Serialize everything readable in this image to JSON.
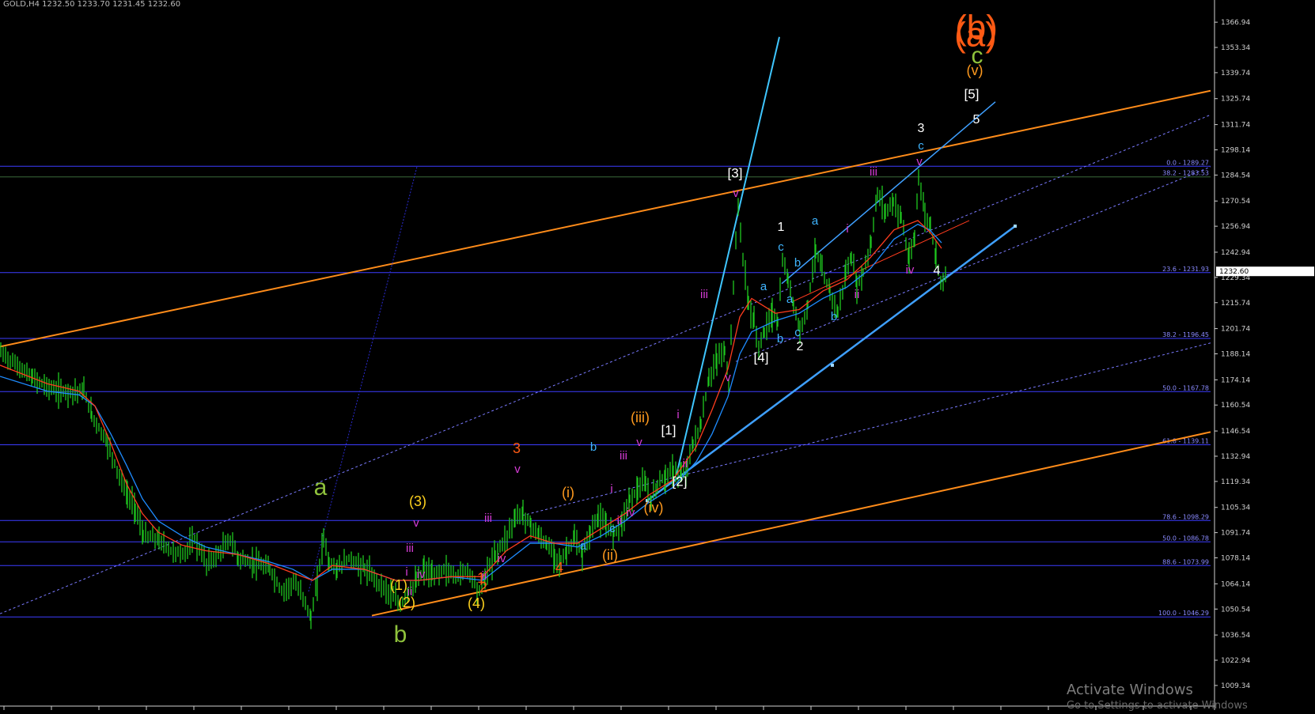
{
  "header": {
    "title_strip": "GOLD,H4 1232.50 1233.70 1231.45 1232.60"
  },
  "watermark": {
    "line1": "Activate Windows",
    "line2": "Go to Settings to activate Windows"
  },
  "chart_data": {
    "type": "line",
    "symbol": "GOLD,H4",
    "y_axis": {
      "ticks": [
        1366.94,
        1353.34,
        1339.74,
        1325.74,
        1311.74,
        1298.14,
        1284.54,
        1270.54,
        1256.94,
        1242.94,
        1229.34,
        1215.74,
        1201.74,
        1188.14,
        1174.14,
        1160.54,
        1146.54,
        1132.94,
        1119.34,
        1105.34,
        1091.74,
        1078.14,
        1064.14,
        1050.54,
        1036.54,
        1022.94,
        1009.34
      ],
      "last_price": "1232.60",
      "range": [
        1003.5,
        1377
      ]
    },
    "fib_levels": [
      {
        "label": "0.0 - 1289.27",
        "value": 1289.27
      },
      {
        "label": "38.2 - 1283.53",
        "value": 1283.53
      },
      {
        "label": "23.6 - 1231.93",
        "value": 1231.93
      },
      {
        "label": "38.2 - 1196.45",
        "value": 1196.45
      },
      {
        "label": "50.0 - 1167.78",
        "value": 1167.78
      },
      {
        "label": "61.8 - 1139.11",
        "value": 1139.11
      },
      {
        "label": "78.6 - 1098.29",
        "value": 1098.29
      },
      {
        "label": "50.0 - 1086.78",
        "value": 1086.78
      },
      {
        "label": "88.6 - 1073.99",
        "value": 1073.99
      },
      {
        "label": "100.0 - 1046.29",
        "value": 1046.29
      }
    ],
    "price_path": [
      [
        0,
        1189
      ],
      [
        40,
        1175
      ],
      [
        70,
        1168
      ],
      [
        105,
        1168
      ],
      [
        115,
        1155
      ],
      [
        135,
        1140
      ],
      [
        150,
        1122
      ],
      [
        160,
        1112
      ],
      [
        170,
        1105
      ],
      [
        180,
        1090
      ],
      [
        200,
        1088
      ],
      [
        215,
        1082
      ],
      [
        230,
        1080
      ],
      [
        245,
        1088
      ],
      [
        260,
        1075
      ],
      [
        275,
        1080
      ],
      [
        290,
        1088
      ],
      [
        300,
        1078
      ],
      [
        320,
        1075
      ],
      [
        340,
        1072
      ],
      [
        355,
        1060
      ],
      [
        370,
        1065
      ],
      [
        385,
        1055
      ],
      [
        392,
        1045
      ],
      [
        400,
        1065
      ],
      [
        408,
        1090
      ],
      [
        415,
        1075
      ],
      [
        425,
        1072
      ],
      [
        440,
        1078
      ],
      [
        460,
        1072
      ],
      [
        475,
        1066
      ],
      [
        490,
        1060
      ],
      [
        505,
        1052
      ],
      [
        515,
        1060
      ],
      [
        525,
        1065
      ],
      [
        535,
        1072
      ],
      [
        545,
        1068
      ],
      [
        560,
        1072
      ],
      [
        575,
        1068
      ],
      [
        590,
        1072
      ],
      [
        605,
        1060
      ],
      [
        612,
        1068
      ],
      [
        625,
        1080
      ],
      [
        640,
        1090
      ],
      [
        650,
        1100
      ],
      [
        660,
        1102
      ],
      [
        670,
        1096
      ],
      [
        680,
        1090
      ],
      [
        690,
        1085
      ],
      [
        700,
        1080
      ],
      [
        708,
        1075
      ],
      [
        715,
        1082
      ],
      [
        725,
        1088
      ],
      [
        735,
        1080
      ],
      [
        745,
        1092
      ],
      [
        755,
        1100
      ],
      [
        765,
        1095
      ],
      [
        775,
        1092
      ],
      [
        785,
        1098
      ],
      [
        795,
        1110
      ],
      [
        805,
        1115
      ],
      [
        815,
        1118
      ],
      [
        822,
        1108
      ],
      [
        830,
        1118
      ],
      [
        840,
        1122
      ],
      [
        850,
        1125
      ],
      [
        860,
        1122
      ],
      [
        868,
        1128
      ],
      [
        875,
        1140
      ],
      [
        885,
        1150
      ],
      [
        895,
        1175
      ],
      [
        905,
        1185
      ],
      [
        915,
        1190
      ],
      [
        920,
        1172
      ],
      [
        926,
        1225
      ],
      [
        932,
        1268
      ],
      [
        938,
        1240
      ],
      [
        945,
        1215
      ],
      [
        952,
        1205
      ],
      [
        958,
        1192
      ],
      [
        965,
        1200
      ],
      [
        975,
        1210
      ],
      [
        982,
        1205
      ],
      [
        988,
        1238
      ],
      [
        995,
        1228
      ],
      [
        1002,
        1215
      ],
      [
        1010,
        1200
      ],
      [
        1020,
        1215
      ],
      [
        1030,
        1245
      ],
      [
        1038,
        1232
      ],
      [
        1048,
        1222
      ],
      [
        1058,
        1210
      ],
      [
        1068,
        1232
      ],
      [
        1075,
        1240
      ],
      [
        1082,
        1225
      ],
      [
        1090,
        1232
      ],
      [
        1100,
        1248
      ],
      [
        1108,
        1275
      ],
      [
        1118,
        1265
      ],
      [
        1128,
        1270
      ],
      [
        1138,
        1262
      ],
      [
        1148,
        1238
      ],
      [
        1155,
        1250
      ],
      [
        1160,
        1285
      ],
      [
        1168,
        1262
      ],
      [
        1175,
        1258
      ],
      [
        1182,
        1240
      ],
      [
        1188,
        1228
      ],
      [
        1196,
        1232
      ]
    ],
    "ma_red": [
      [
        0,
        1182
      ],
      [
        60,
        1172
      ],
      [
        100,
        1168
      ],
      [
        120,
        1160
      ],
      [
        140,
        1140
      ],
      [
        160,
        1118
      ],
      [
        180,
        1102
      ],
      [
        200,
        1092
      ],
      [
        230,
        1085
      ],
      [
        260,
        1082
      ],
      [
        300,
        1080
      ],
      [
        340,
        1075
      ],
      [
        370,
        1070
      ],
      [
        395,
        1066
      ],
      [
        420,
        1074
      ],
      [
        460,
        1072
      ],
      [
        500,
        1066
      ],
      [
        530,
        1066
      ],
      [
        570,
        1068
      ],
      [
        610,
        1068
      ],
      [
        640,
        1082
      ],
      [
        670,
        1090
      ],
      [
        700,
        1086
      ],
      [
        730,
        1086
      ],
      [
        760,
        1094
      ],
      [
        790,
        1102
      ],
      [
        820,
        1112
      ],
      [
        850,
        1120
      ],
      [
        880,
        1138
      ],
      [
        900,
        1158
      ],
      [
        920,
        1180
      ],
      [
        935,
        1208
      ],
      [
        950,
        1218
      ],
      [
        980,
        1210
      ],
      [
        1010,
        1212
      ],
      [
        1040,
        1222
      ],
      [
        1070,
        1228
      ],
      [
        1100,
        1240
      ],
      [
        1130,
        1255
      ],
      [
        1160,
        1260
      ],
      [
        1175,
        1254
      ],
      [
        1190,
        1245
      ]
    ],
    "ma_blue": [
      [
        0,
        1176
      ],
      [
        60,
        1168
      ],
      [
        100,
        1166
      ],
      [
        120,
        1160
      ],
      [
        140,
        1145
      ],
      [
        160,
        1128
      ],
      [
        180,
        1110
      ],
      [
        200,
        1098
      ],
      [
        230,
        1090
      ],
      [
        260,
        1084
      ],
      [
        300,
        1080
      ],
      [
        340,
        1076
      ],
      [
        370,
        1072
      ],
      [
        395,
        1066
      ],
      [
        420,
        1072
      ],
      [
        460,
        1072
      ],
      [
        500,
        1066
      ],
      [
        530,
        1066
      ],
      [
        570,
        1068
      ],
      [
        610,
        1066
      ],
      [
        640,
        1076
      ],
      [
        670,
        1086
      ],
      [
        700,
        1086
      ],
      [
        730,
        1084
      ],
      [
        760,
        1090
      ],
      [
        790,
        1098
      ],
      [
        820,
        1108
      ],
      [
        850,
        1116
      ],
      [
        880,
        1130
      ],
      [
        900,
        1145
      ],
      [
        920,
        1165
      ],
      [
        935,
        1188
      ],
      [
        950,
        1200
      ],
      [
        980,
        1206
      ],
      [
        1010,
        1210
      ],
      [
        1040,
        1218
      ],
      [
        1070,
        1224
      ],
      [
        1100,
        1234
      ],
      [
        1130,
        1250
      ],
      [
        1160,
        1258
      ],
      [
        1175,
        1255
      ],
      [
        1190,
        1248
      ]
    ],
    "wave_labels": [
      {
        "text": "(a)",
        "color": "#ff5a14",
        "size": 44
      },
      {
        "text": "c",
        "color": "#8fc23c",
        "size": 30
      },
      {
        "text": "(v)",
        "color": "#ff9a1e",
        "size": 18
      },
      {
        "text": "[5]",
        "color": "#ffffff",
        "size": 17
      },
      {
        "text": "5",
        "color": "#ffffff",
        "size": 16
      },
      {
        "text": "3",
        "color": "#ffffff",
        "size": 16
      },
      {
        "text": "c",
        "color": "#3fb5ff",
        "size": 15
      },
      {
        "text": "v",
        "color": "#d63cd6",
        "size": 15
      },
      {
        "text": "iii",
        "color": "#d63cd6",
        "size": 15
      },
      {
        "text": "[3]",
        "color": "#ffffff",
        "size": 17
      },
      {
        "text": "v",
        "color": "#d63cd6",
        "size": 15
      },
      {
        "text": "1",
        "color": "#ffffff",
        "size": 16
      },
      {
        "text": "a",
        "color": "#3fb5ff",
        "size": 15
      },
      {
        "text": "c",
        "color": "#3fb5ff",
        "size": 15
      },
      {
        "text": "b",
        "color": "#3fb5ff",
        "size": 15
      },
      {
        "text": "i",
        "color": "#d63cd6",
        "size": 15
      },
      {
        "text": "iii",
        "color": "#d63cd6",
        "size": 15
      },
      {
        "text": "a",
        "color": "#3fb5ff",
        "size": 15
      },
      {
        "text": "a",
        "color": "#3fb5ff",
        "size": 15
      },
      {
        "text": "iv",
        "color": "#d63cd6",
        "size": 15
      },
      {
        "text": "ii",
        "color": "#d63cd6",
        "size": 15
      },
      {
        "text": "4",
        "color": "#ffffff",
        "size": 16
      },
      {
        "text": "c",
        "color": "#3fb5ff",
        "size": 15
      },
      {
        "text": "b",
        "color": "#3fb5ff",
        "size": 15
      },
      {
        "text": "b",
        "color": "#3fb5ff",
        "size": 15
      },
      {
        "text": "2",
        "color": "#ffffff",
        "size": 16
      },
      {
        "text": "[4]",
        "color": "#ffffff",
        "size": 17
      },
      {
        "text": "v",
        "color": "#d63cd6",
        "size": 15
      },
      {
        "text": "(iii)",
        "color": "#ff9a1e",
        "size": 18
      },
      {
        "text": "[1]",
        "color": "#ffffff",
        "size": 17
      },
      {
        "text": "i",
        "color": "#d63cd6",
        "size": 15
      },
      {
        "text": "v",
        "color": "#d63cd6",
        "size": 15
      },
      {
        "text": "iii",
        "color": "#d63cd6",
        "size": 15
      },
      {
        "text": "ii",
        "color": "#d63cd6",
        "size": 15
      },
      {
        "text": "[2]",
        "color": "#ffffff",
        "size": 17
      },
      {
        "text": "3",
        "color": "#ff5a14",
        "size": 18
      },
      {
        "text": "v",
        "color": "#d63cd6",
        "size": 15
      },
      {
        "text": "b",
        "color": "#3fb5ff",
        "size": 15
      },
      {
        "text": "i",
        "color": "#d63cd6",
        "size": 15
      },
      {
        "text": "(i)",
        "color": "#ff9a1e",
        "size": 18
      },
      {
        "text": "(iv)",
        "color": "#ff9a1e",
        "size": 18
      },
      {
        "text": "iv",
        "color": "#d63cd6",
        "size": 15
      },
      {
        "text": "c",
        "color": "#3fb5ff",
        "size": 15
      },
      {
        "text": "ii",
        "color": "#d63cd6",
        "size": 15
      },
      {
        "text": "iii",
        "color": "#d63cd6",
        "size": 15
      },
      {
        "text": "a",
        "color": "#3fb5ff",
        "size": 15
      },
      {
        "text": "(ii)",
        "color": "#ff9a1e",
        "size": 18
      },
      {
        "text": "iv",
        "color": "#d63cd6",
        "size": 15
      },
      {
        "text": "4",
        "color": "#ff5a14",
        "size": 18
      },
      {
        "text": "1",
        "color": "#ff5a14",
        "size": 18
      },
      {
        "text": "ii",
        "color": "#d63cd6",
        "size": 15
      },
      {
        "text": "2",
        "color": "#ff5a14",
        "size": 18
      },
      {
        "text": "(4)",
        "color": "#ffd21e",
        "size": 18
      },
      {
        "text": "(3)",
        "color": "#ffd21e",
        "size": 18
      },
      {
        "text": "v",
        "color": "#d63cd6",
        "size": 15
      },
      {
        "text": "iii",
        "color": "#d63cd6",
        "size": 15
      },
      {
        "text": "i",
        "color": "#d63cd6",
        "size": 15
      },
      {
        "text": "iv",
        "color": "#d63cd6",
        "size": 15
      },
      {
        "text": "(1)",
        "color": "#ffd21e",
        "size": 18
      },
      {
        "text": "ii",
        "color": "#d63cd6",
        "size": 15
      },
      {
        "text": "(2)",
        "color": "#ffd21e",
        "size": 18
      },
      {
        "text": "a",
        "color": "#8fc23c",
        "size": 30
      },
      {
        "text": "b",
        "color": "#8fc23c",
        "size": 30
      },
      {
        "text": "(b)",
        "color": "#ff5a14",
        "size": 44
      }
    ],
    "colors": {
      "background": "#000000",
      "candles": "#1ec81e",
      "fib_lines": "#3c3cff",
      "channel_orange": "#ff8c1a",
      "trend_blue": "#3fa0ff",
      "ma_red": "#ff3c1e",
      "ma_blue": "#1e8cff"
    }
  }
}
